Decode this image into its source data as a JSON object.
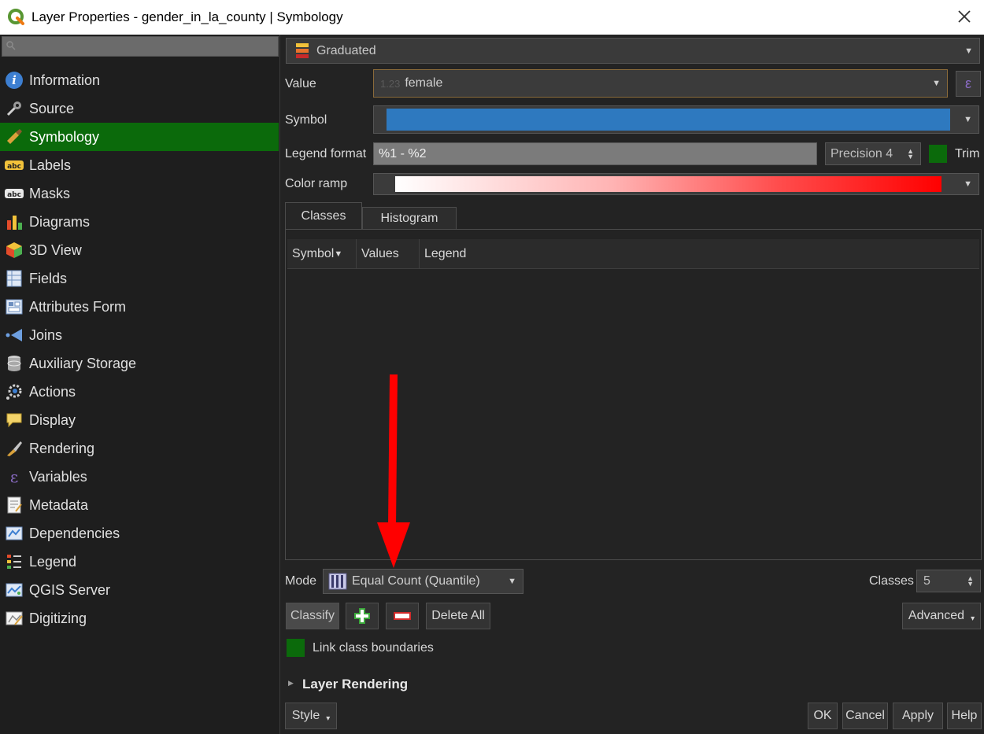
{
  "window": {
    "title": "Layer Properties - gender_in_la_county | Symbology"
  },
  "sidebar": {
    "search_placeholder": "",
    "items": [
      {
        "label": "Information",
        "icon": "info-icon"
      },
      {
        "label": "Source",
        "icon": "wrench-icon"
      },
      {
        "label": "Symbology",
        "icon": "paintbrush-icon",
        "active": true
      },
      {
        "label": "Labels",
        "icon": "abc-label-icon"
      },
      {
        "label": "Masks",
        "icon": "abc-mask-icon"
      },
      {
        "label": "Diagrams",
        "icon": "diagram-icon"
      },
      {
        "label": "3D View",
        "icon": "cube-icon"
      },
      {
        "label": "Fields",
        "icon": "fields-icon"
      },
      {
        "label": "Attributes Form",
        "icon": "form-icon"
      },
      {
        "label": "Joins",
        "icon": "join-icon"
      },
      {
        "label": "Auxiliary Storage",
        "icon": "database-icon"
      },
      {
        "label": "Actions",
        "icon": "gear-icon"
      },
      {
        "label": "Display",
        "icon": "speech-bubble-icon"
      },
      {
        "label": "Rendering",
        "icon": "brush-icon"
      },
      {
        "label": "Variables",
        "icon": "epsilon-icon"
      },
      {
        "label": "Metadata",
        "icon": "metadata-icon"
      },
      {
        "label": "Dependencies",
        "icon": "dependencies-icon"
      },
      {
        "label": "Legend",
        "icon": "legend-icon"
      },
      {
        "label": "QGIS Server",
        "icon": "server-icon"
      },
      {
        "label": "Digitizing",
        "icon": "digitizing-icon"
      }
    ]
  },
  "symbology": {
    "renderer": "Graduated",
    "value_label": "Value",
    "value_field": "female",
    "value_type_hint": "1.23",
    "symbol_label": "Symbol",
    "symbol_color": "#2e79bf",
    "legend_format_label": "Legend format",
    "legend_format": "%1 - %2",
    "precision": "Precision 4",
    "trim_label": "Trim",
    "color_ramp_label": "Color ramp",
    "tabs": [
      "Classes",
      "Histogram"
    ],
    "columns": [
      "Symbol",
      "Values",
      "Legend"
    ],
    "mode_label": "Mode",
    "mode_value": "Equal Count (Quantile)",
    "classes_label": "Classes",
    "classes_value": "5",
    "buttons": {
      "classify": "Classify",
      "delete_all": "Delete All",
      "advanced": "Advanced"
    },
    "link_label": "Link class boundaries",
    "layer_rendering": "Layer Rendering"
  },
  "footer": {
    "style": "Style",
    "ok": "OK",
    "cancel": "Cancel",
    "apply": "Apply",
    "help": "Help"
  },
  "colors": {
    "active_green": "#0b6a0b",
    "annotation_arrow": "#ff0000"
  }
}
